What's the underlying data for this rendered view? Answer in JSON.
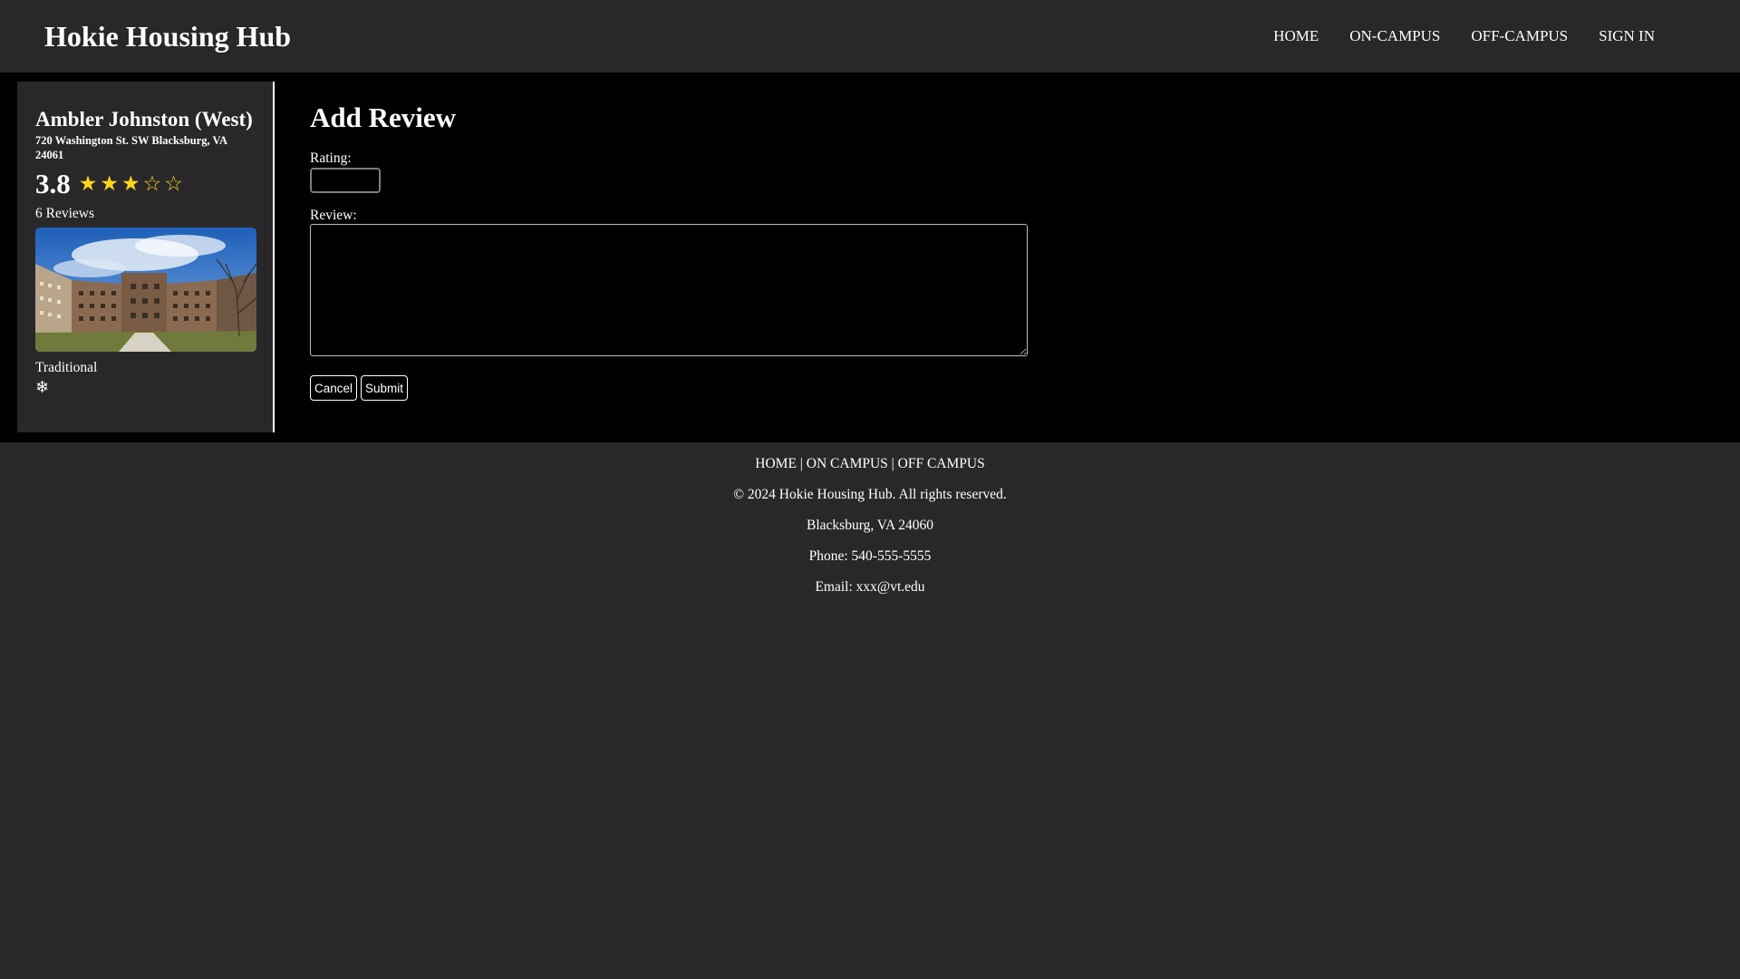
{
  "header": {
    "title": "Hokie Housing Hub",
    "nav": [
      "HOME",
      "ON-CAMPUS",
      "OFF-CAMPUS",
      "SIGN IN"
    ]
  },
  "card": {
    "name": "Ambler Johnston (West)",
    "address": "720 Washington St. SW Blacksburg, VA 24061",
    "rating": "3.8",
    "stars_filled": 3,
    "stars_total": 5,
    "reviews": "6 Reviews",
    "type": "Traditional",
    "amenity_icon": "snowflake-icon",
    "star_color": "#ffd51a"
  },
  "form": {
    "title": "Add Review",
    "rating_label": "Rating:",
    "rating_value": "",
    "review_label": "Review:",
    "review_value": "",
    "cancel_label": "Cancel",
    "submit_label": "Submit"
  },
  "footer": {
    "links": [
      "HOME",
      "ON CAMPUS",
      "OFF CAMPUS"
    ],
    "separator": "|",
    "copyright": "© 2024 Hokie Housing Hub. All rights reserved.",
    "location": "Blacksburg, VA 24060",
    "phone": "Phone: 540-555-5555",
    "email": "Email: xxx@vt.edu"
  },
  "colors": {
    "background": "#28282b",
    "main_background": "#000000",
    "text": "#ffffff"
  }
}
